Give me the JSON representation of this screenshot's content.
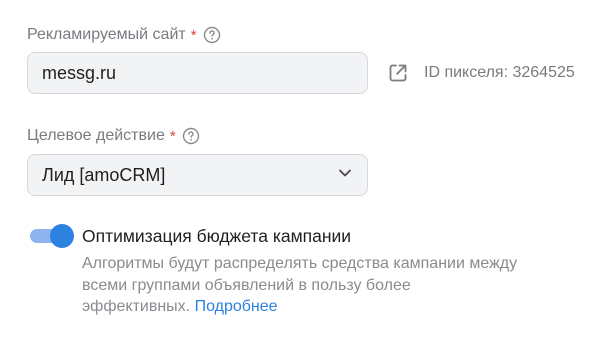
{
  "site_field": {
    "label": "Рекламируемый сайт",
    "required_mark": "*",
    "help_icon": "question-circle-icon",
    "value": "messg.ru",
    "open_icon": "external-link-icon",
    "pixel_id": "ID пикселя: 3264525"
  },
  "action_field": {
    "label": "Целевое действие",
    "required_mark": "*",
    "help_icon": "question-circle-icon",
    "selected": "Лид [amoCRM]",
    "chevron_icon": "chevron-down-icon"
  },
  "budget_optimization": {
    "enabled": true,
    "title": "Оптимизация бюджета кампании",
    "description_line1": "Алгоритмы будут распределять средства кампании между",
    "description_line2": "всеми группами объявлений в пользу более",
    "description_line3": "эффективных.",
    "more_link": "Подробнее"
  },
  "colors": {
    "accent": "#2d81e0",
    "required": "#e0443b",
    "muted_text": "#7a7a80"
  }
}
